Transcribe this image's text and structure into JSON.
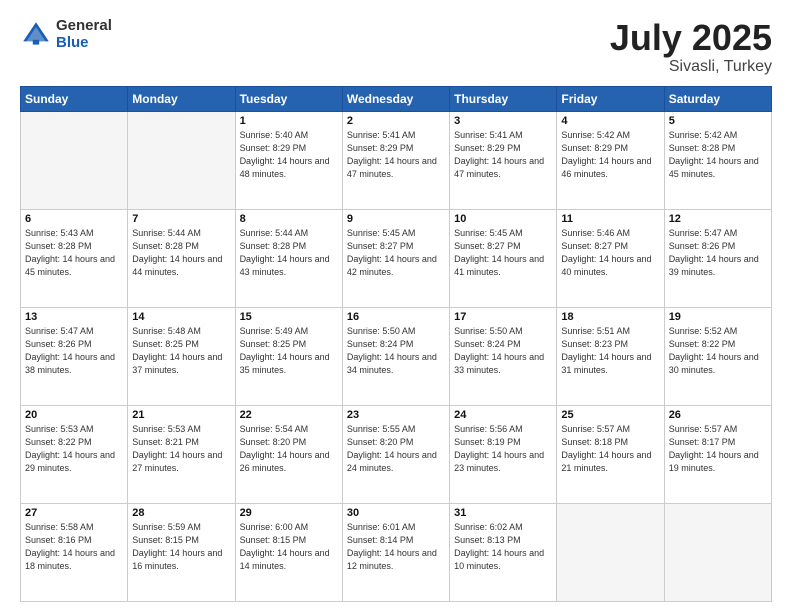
{
  "header": {
    "logo_general": "General",
    "logo_blue": "Blue",
    "title": "July 2025",
    "subtitle": "Sivasli, Turkey"
  },
  "weekdays": [
    "Sunday",
    "Monday",
    "Tuesday",
    "Wednesday",
    "Thursday",
    "Friday",
    "Saturday"
  ],
  "weeks": [
    [
      {
        "day": "",
        "sunrise": "",
        "sunset": "",
        "daylight": ""
      },
      {
        "day": "",
        "sunrise": "",
        "sunset": "",
        "daylight": ""
      },
      {
        "day": "1",
        "sunrise": "Sunrise: 5:40 AM",
        "sunset": "Sunset: 8:29 PM",
        "daylight": "Daylight: 14 hours and 48 minutes."
      },
      {
        "day": "2",
        "sunrise": "Sunrise: 5:41 AM",
        "sunset": "Sunset: 8:29 PM",
        "daylight": "Daylight: 14 hours and 47 minutes."
      },
      {
        "day": "3",
        "sunrise": "Sunrise: 5:41 AM",
        "sunset": "Sunset: 8:29 PM",
        "daylight": "Daylight: 14 hours and 47 minutes."
      },
      {
        "day": "4",
        "sunrise": "Sunrise: 5:42 AM",
        "sunset": "Sunset: 8:29 PM",
        "daylight": "Daylight: 14 hours and 46 minutes."
      },
      {
        "day": "5",
        "sunrise": "Sunrise: 5:42 AM",
        "sunset": "Sunset: 8:28 PM",
        "daylight": "Daylight: 14 hours and 45 minutes."
      }
    ],
    [
      {
        "day": "6",
        "sunrise": "Sunrise: 5:43 AM",
        "sunset": "Sunset: 8:28 PM",
        "daylight": "Daylight: 14 hours and 45 minutes."
      },
      {
        "day": "7",
        "sunrise": "Sunrise: 5:44 AM",
        "sunset": "Sunset: 8:28 PM",
        "daylight": "Daylight: 14 hours and 44 minutes."
      },
      {
        "day": "8",
        "sunrise": "Sunrise: 5:44 AM",
        "sunset": "Sunset: 8:28 PM",
        "daylight": "Daylight: 14 hours and 43 minutes."
      },
      {
        "day": "9",
        "sunrise": "Sunrise: 5:45 AM",
        "sunset": "Sunset: 8:27 PM",
        "daylight": "Daylight: 14 hours and 42 minutes."
      },
      {
        "day": "10",
        "sunrise": "Sunrise: 5:45 AM",
        "sunset": "Sunset: 8:27 PM",
        "daylight": "Daylight: 14 hours and 41 minutes."
      },
      {
        "day": "11",
        "sunrise": "Sunrise: 5:46 AM",
        "sunset": "Sunset: 8:27 PM",
        "daylight": "Daylight: 14 hours and 40 minutes."
      },
      {
        "day": "12",
        "sunrise": "Sunrise: 5:47 AM",
        "sunset": "Sunset: 8:26 PM",
        "daylight": "Daylight: 14 hours and 39 minutes."
      }
    ],
    [
      {
        "day": "13",
        "sunrise": "Sunrise: 5:47 AM",
        "sunset": "Sunset: 8:26 PM",
        "daylight": "Daylight: 14 hours and 38 minutes."
      },
      {
        "day": "14",
        "sunrise": "Sunrise: 5:48 AM",
        "sunset": "Sunset: 8:25 PM",
        "daylight": "Daylight: 14 hours and 37 minutes."
      },
      {
        "day": "15",
        "sunrise": "Sunrise: 5:49 AM",
        "sunset": "Sunset: 8:25 PM",
        "daylight": "Daylight: 14 hours and 35 minutes."
      },
      {
        "day": "16",
        "sunrise": "Sunrise: 5:50 AM",
        "sunset": "Sunset: 8:24 PM",
        "daylight": "Daylight: 14 hours and 34 minutes."
      },
      {
        "day": "17",
        "sunrise": "Sunrise: 5:50 AM",
        "sunset": "Sunset: 8:24 PM",
        "daylight": "Daylight: 14 hours and 33 minutes."
      },
      {
        "day": "18",
        "sunrise": "Sunrise: 5:51 AM",
        "sunset": "Sunset: 8:23 PM",
        "daylight": "Daylight: 14 hours and 31 minutes."
      },
      {
        "day": "19",
        "sunrise": "Sunrise: 5:52 AM",
        "sunset": "Sunset: 8:22 PM",
        "daylight": "Daylight: 14 hours and 30 minutes."
      }
    ],
    [
      {
        "day": "20",
        "sunrise": "Sunrise: 5:53 AM",
        "sunset": "Sunset: 8:22 PM",
        "daylight": "Daylight: 14 hours and 29 minutes."
      },
      {
        "day": "21",
        "sunrise": "Sunrise: 5:53 AM",
        "sunset": "Sunset: 8:21 PM",
        "daylight": "Daylight: 14 hours and 27 minutes."
      },
      {
        "day": "22",
        "sunrise": "Sunrise: 5:54 AM",
        "sunset": "Sunset: 8:20 PM",
        "daylight": "Daylight: 14 hours and 26 minutes."
      },
      {
        "day": "23",
        "sunrise": "Sunrise: 5:55 AM",
        "sunset": "Sunset: 8:20 PM",
        "daylight": "Daylight: 14 hours and 24 minutes."
      },
      {
        "day": "24",
        "sunrise": "Sunrise: 5:56 AM",
        "sunset": "Sunset: 8:19 PM",
        "daylight": "Daylight: 14 hours and 23 minutes."
      },
      {
        "day": "25",
        "sunrise": "Sunrise: 5:57 AM",
        "sunset": "Sunset: 8:18 PM",
        "daylight": "Daylight: 14 hours and 21 minutes."
      },
      {
        "day": "26",
        "sunrise": "Sunrise: 5:57 AM",
        "sunset": "Sunset: 8:17 PM",
        "daylight": "Daylight: 14 hours and 19 minutes."
      }
    ],
    [
      {
        "day": "27",
        "sunrise": "Sunrise: 5:58 AM",
        "sunset": "Sunset: 8:16 PM",
        "daylight": "Daylight: 14 hours and 18 minutes."
      },
      {
        "day": "28",
        "sunrise": "Sunrise: 5:59 AM",
        "sunset": "Sunset: 8:15 PM",
        "daylight": "Daylight: 14 hours and 16 minutes."
      },
      {
        "day": "29",
        "sunrise": "Sunrise: 6:00 AM",
        "sunset": "Sunset: 8:15 PM",
        "daylight": "Daylight: 14 hours and 14 minutes."
      },
      {
        "day": "30",
        "sunrise": "Sunrise: 6:01 AM",
        "sunset": "Sunset: 8:14 PM",
        "daylight": "Daylight: 14 hours and 12 minutes."
      },
      {
        "day": "31",
        "sunrise": "Sunrise: 6:02 AM",
        "sunset": "Sunset: 8:13 PM",
        "daylight": "Daylight: 14 hours and 10 minutes."
      },
      {
        "day": "",
        "sunrise": "",
        "sunset": "",
        "daylight": ""
      },
      {
        "day": "",
        "sunrise": "",
        "sunset": "",
        "daylight": ""
      }
    ]
  ]
}
